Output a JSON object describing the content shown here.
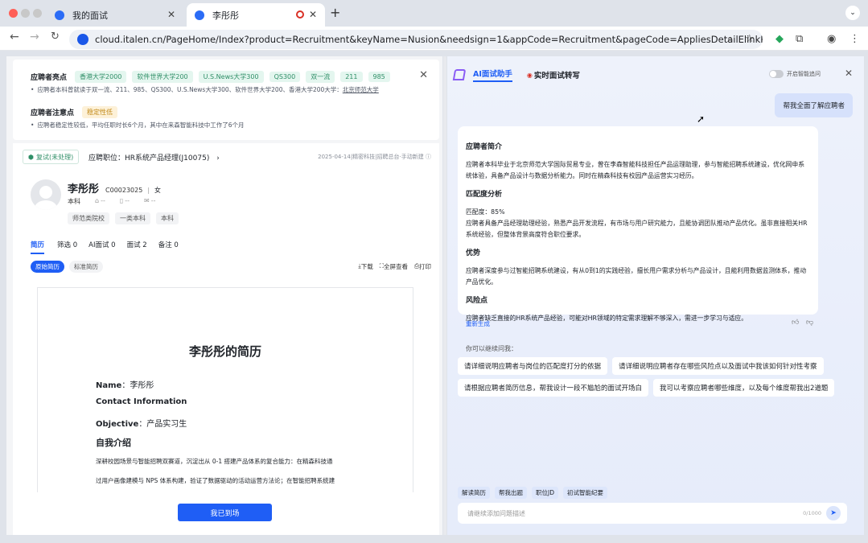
{
  "browser": {
    "tabs": [
      {
        "title": "我的面试",
        "active": false
      },
      {
        "title": "李彤彤",
        "active": true
      }
    ],
    "url": "cloud.italen.cn/PageHome/Index?product=Recruitment&keyName=Nusion&needsign=1&appCode=Recruitment&pageCode=AppliesDetailElinkPage&applyId=5..."
  },
  "highlights": {
    "title": "应聘者亮点",
    "tags": [
      "香港大学2000",
      "软件世界大学200",
      "U.S.News大学300",
      "QS300",
      "双一流",
      "211",
      "985"
    ],
    "detail": "应聘者本科曾就读于双一流、211、985、QS300、U.S.News大学300、软件世界大学200、香港大学200大学：",
    "detail_link": "北京师范大学"
  },
  "notes": {
    "title": "应聘者注意点",
    "tag": "稳定性低",
    "detail": "应聘者稳定性较低，平均任职时长6个月，其中在来森智能科技中工作了6个月"
  },
  "candidate": {
    "status": "复试(未处理)",
    "position_label": "应聘职位：HR系统产品经理(J10075)",
    "meta": "2025-04-14|精密科技|招聘总台·手动新建",
    "name": "李彤彤",
    "id": "C00023025",
    "gender": "女",
    "education": "本科",
    "dash1": "--",
    "dash2": "--",
    "dash3": "--",
    "badges": [
      "师范类院校",
      "一类本科",
      "本科"
    ]
  },
  "resume_tabs": [
    "简历",
    "筛选 0",
    "AI面试 0",
    "面试 2",
    "备注 0"
  ],
  "resume_subtabs": [
    "原始简历",
    "标准简历"
  ],
  "resume_actions": [
    "下载",
    "全屏查看",
    "打印"
  ],
  "resume": {
    "heading": "李彤彤的简历",
    "name_label": "Name",
    "name_value": "：李彤彤",
    "contact_label": "Contact Information",
    "objective_label": "Objective",
    "objective_value": "：产品实习生",
    "intro_heading": "自我介绍",
    "intro_line1": "深耕校园场景与智能招聘双赛道，沉淀出从 0-1 搭建产品体系的复合能力：在精森科技通",
    "intro_line2": "过用户画像建模与 NPS 体系构建，验证了数据驱动的活动运营方法论；在智能招聘系统建"
  },
  "primary_button": "我已到场",
  "assistant": {
    "title": "AI面试助手",
    "tab2": "实时面试转写",
    "toggle_label": "开启智能追问",
    "user_message": "帮我全面了解应聘者",
    "sections": [
      {
        "title": "应聘者简介",
        "body": "应聘者本科毕业于北京师范大学国际贸易专业，曾在李森智能科技担任产品运理助理，参与智能招聘系统建设，优化网申系统体验，具备产品设计与数据分析能力。同时在精森科技有校园产品运营实习经历。"
      },
      {
        "title": "匹配度分析",
        "body": "匹配度：85%\n应聘者具备产品经理助理经验，熟悉产品开发流程，有市场与用户研究能力，且能协调团队推动产品优化。虽非直接相关HR系统经验，但整体背景高度符合职位要求。"
      },
      {
        "title": "优势",
        "body": "应聘者深度参与过智能招聘系统建设，有从0到1的实践经验，擅长用户需求分析与产品设计，且能利用数据监测体系，推动产品优化。"
      },
      {
        "title": "风险点",
        "body": "应聘者缺乏直接的HR系统产品经验，可能对HR领域的特定需求理解不够深入，需进一步学习与适应。"
      }
    ],
    "regenerate": "重新生成",
    "suggest_label": "你可以继续问我：",
    "suggestions": [
      "请详细说明应聘者与岗位的匹配度打分的依据",
      "请详细说明应聘者存在哪些风险点以及面试中我该如何针对性考察",
      "请根据应聘者简历信息，帮我设计一段不尴尬的面试开场白",
      "我可以考察应聘者哪些维度，以及每个维度帮我出2道题"
    ],
    "quick_actions": [
      "解读简历",
      "帮我出题",
      "职位JD",
      "初试智能纪要"
    ],
    "input_placeholder": "请继续添加问题描述",
    "counter": "0/1000"
  }
}
